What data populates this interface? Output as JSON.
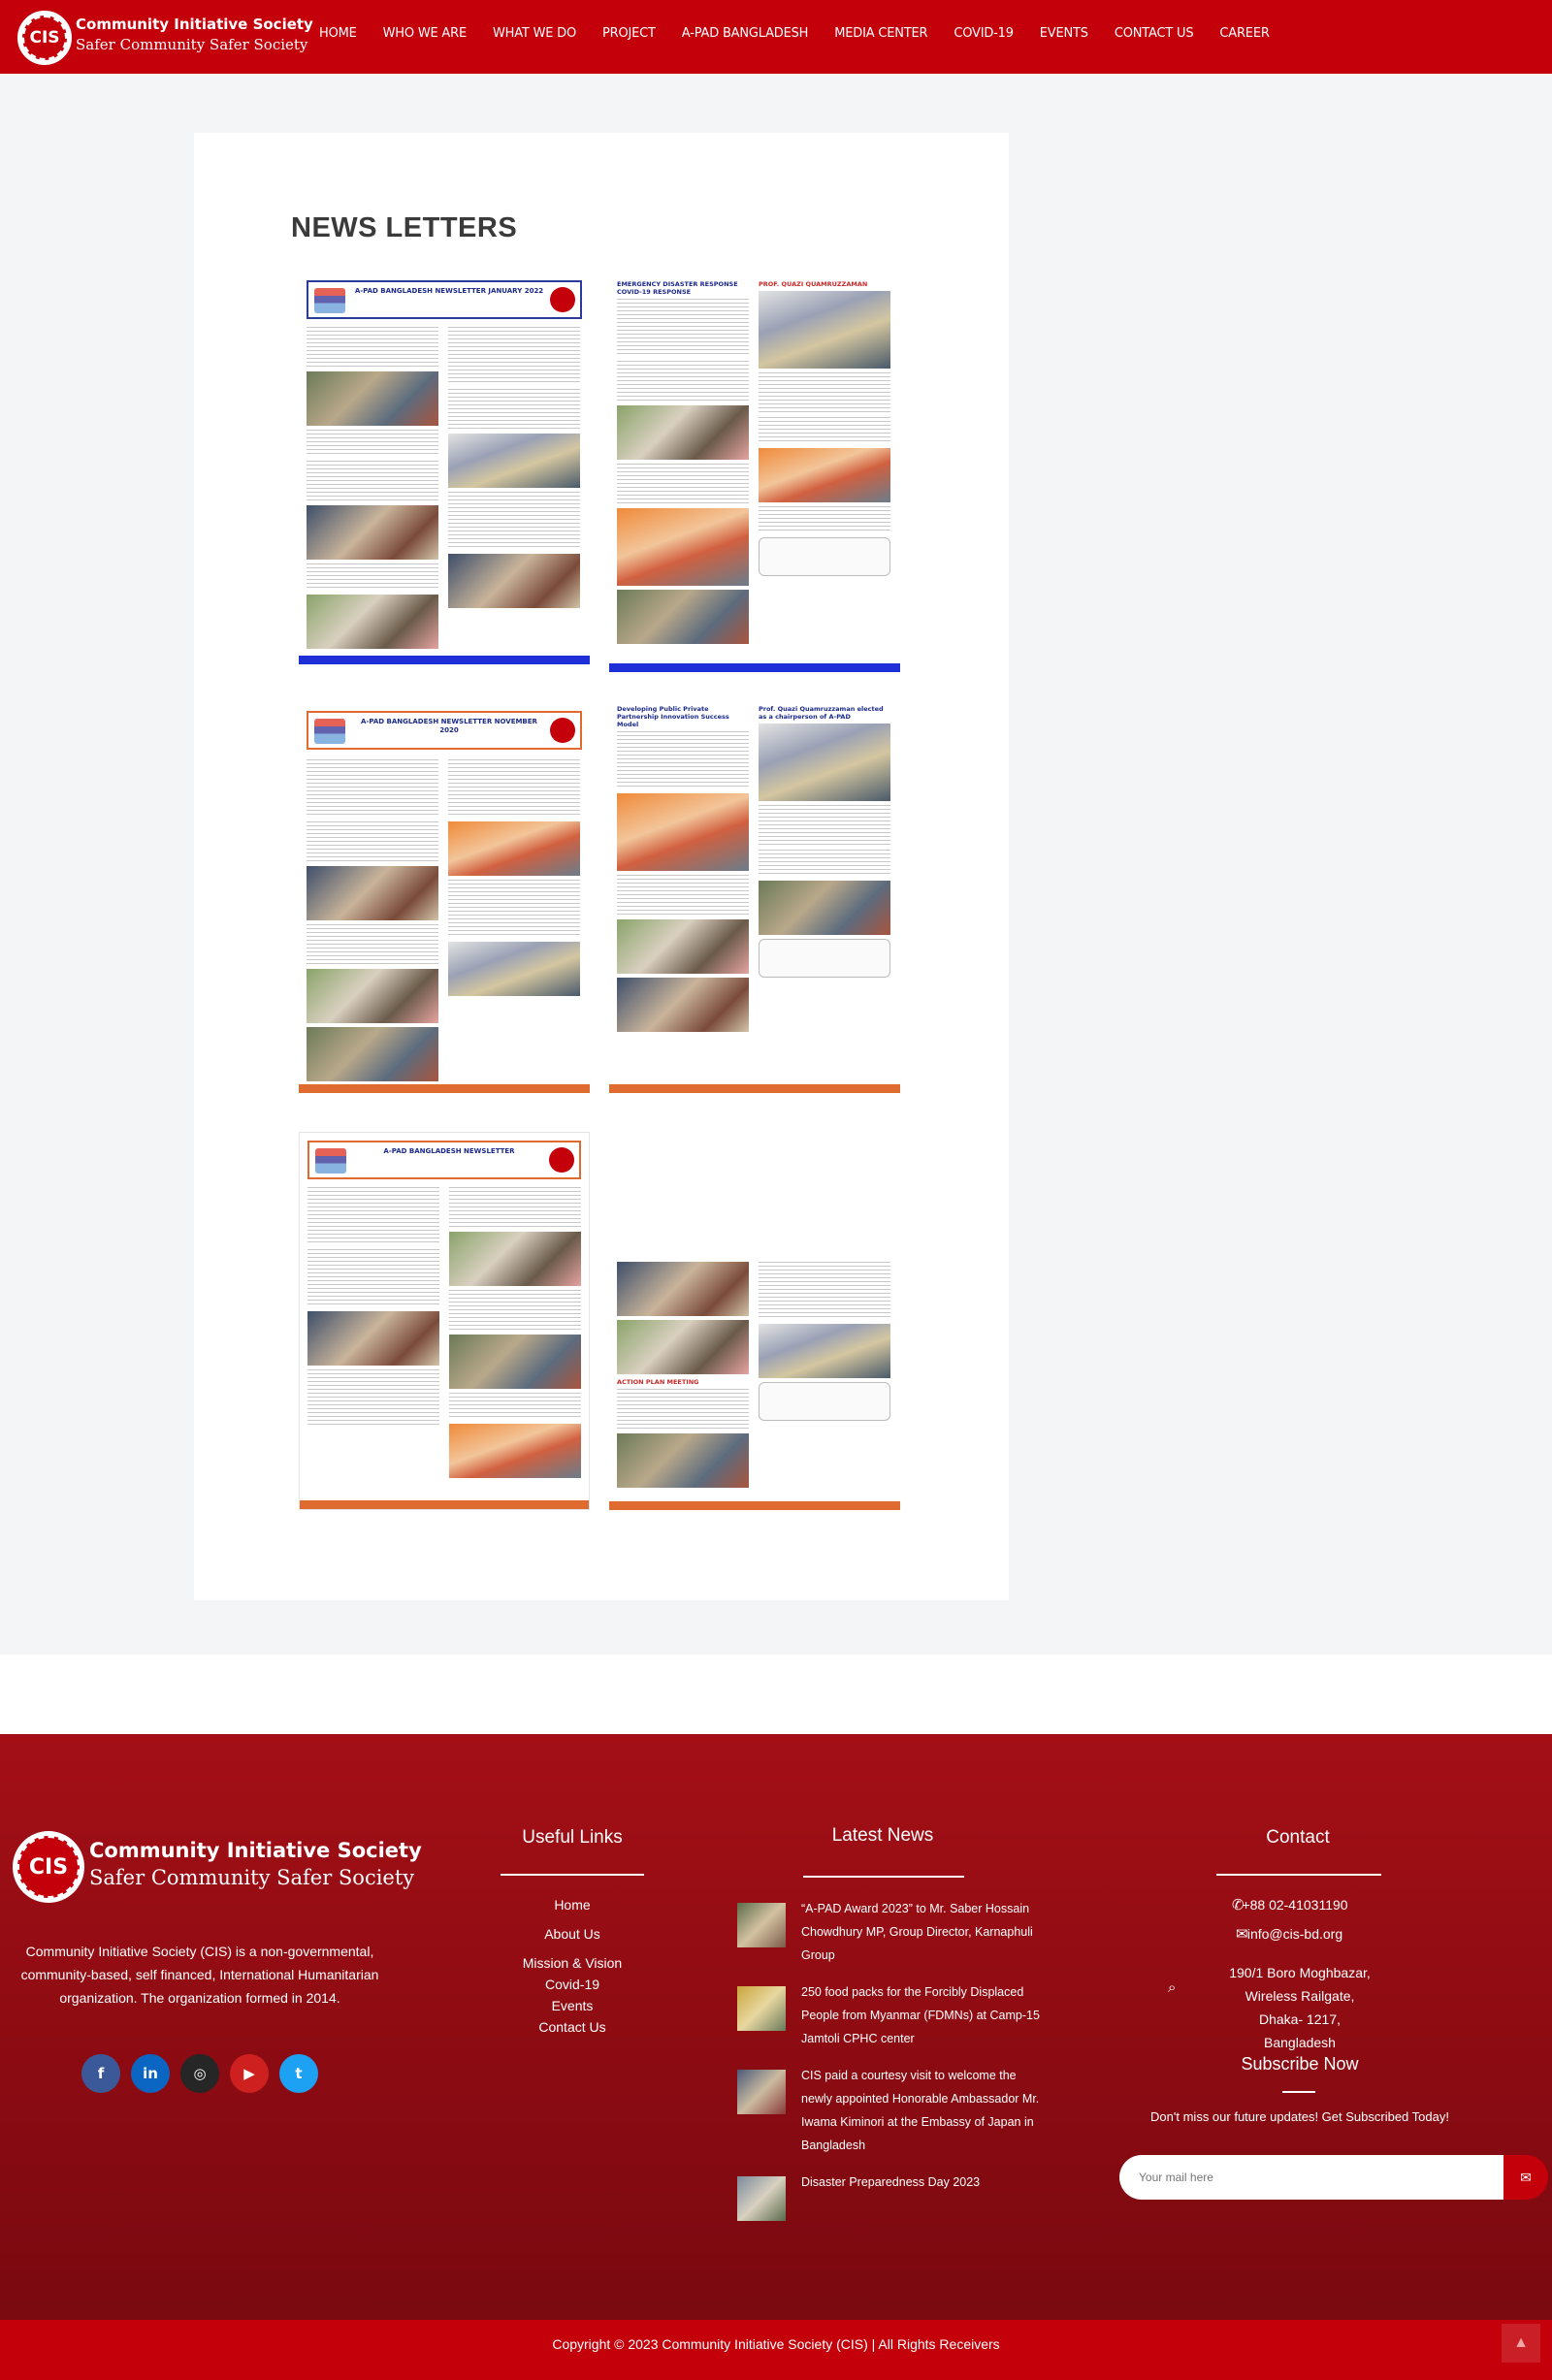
{
  "header": {
    "logo_text": "CIS",
    "org_name": "Community Initiative Society",
    "tagline": "Safer Community Safer Society",
    "nav": [
      "HOME",
      "WHO WE ARE",
      "WHAT WE DO",
      "PROJECT",
      "A-PAD BANGLADESH",
      "MEDIA CENTER",
      "COVID-19",
      "EVENTS",
      "CONTACT US",
      "CAREER"
    ]
  },
  "main": {
    "title": "NEWS LETTERS",
    "newsletters": [
      {
        "heading": "A-PAD BANGLADESH NEWSLETTER JANUARY 2022",
        "bar_color": "#1f2fd8"
      },
      {
        "heading": "EMERGENCY DISASTER RESPONSE COVID-19 RESPONSE",
        "bar_color": "#1f2fd8"
      },
      {
        "heading": "A-PAD BANGLADESH NEWSLETTER NOVEMBER 2020",
        "bar_color": "#e06b30"
      },
      {
        "heading": "Developing Public Private Partnership Innovation Success Model",
        "bar_color": "#e06b30"
      },
      {
        "heading": "A-PAD BANGLADESH NEWSLETTER",
        "bar_color": "#e06b30"
      },
      {
        "heading": "ACTION PLAN MEETING",
        "bar_color": "#e06b30"
      }
    ]
  },
  "footer": {
    "logo_text": "CIS",
    "org_name": "Community Initiative Society",
    "tagline": "Safer Community Safer Society",
    "description": "Community Initiative Society (CIS) is a non-governmental, community-based, self financed, International Humanitarian organization. The organization formed in 2014.",
    "socials": [
      {
        "icon": "facebook-icon",
        "glyph": "f",
        "color": "#3b5998"
      },
      {
        "icon": "linkedin-icon",
        "glyph": "in",
        "color": "#0a66c2"
      },
      {
        "icon": "instagram-icon",
        "glyph": "◎",
        "color": "#262626"
      },
      {
        "icon": "youtube-icon",
        "glyph": "▶",
        "color": "#cd201f"
      },
      {
        "icon": "twitter-icon",
        "glyph": "t",
        "color": "#1da1f2"
      }
    ],
    "useful_links_title": "Useful Links",
    "useful_links": [
      "Home",
      "About Us",
      "Mission & Vision",
      "Covid-19",
      "Events",
      "Contact Us"
    ],
    "news_title": "Latest News",
    "news": [
      "“A-PAD Award 2023” to Mr. Saber Hossain Chowdhury MP, Group Director, Karnaphuli Group",
      "250 food packs for the Forcibly Displaced People from Myanmar (FDMNs) at Camp-15 Jamtoli CPHC center",
      "CIS paid a courtesy visit to welcome the newly appointed Honorable Ambassador Mr. Iwama Kiminori at the Embassy of Japan in Bangladesh",
      "Disaster Preparedness Day 2023"
    ],
    "contact_title": "Contact",
    "phone": "+88 02-41031190",
    "email": "info@cis-bd.org",
    "address": [
      "190/1 Boro Moghbazar,",
      "Wireless Railgate,",
      "Dhaka- 1217, Bangladesh"
    ],
    "subscribe_title": "Subscribe Now",
    "subscribe_text": "Don't miss our future updates! Get Subscribed Today!",
    "email_placeholder": "Your mail here",
    "copyright": "Copyright © 2023 Community Initiative Society (CIS) | All Rights Receivers"
  }
}
